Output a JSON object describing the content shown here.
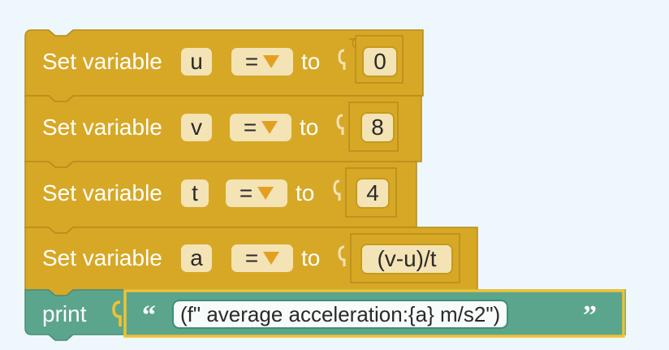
{
  "workspace": {
    "blocks": [
      {
        "kind": "set_variable",
        "label": "Set variable",
        "variable": "u",
        "operator": "=",
        "to_label": "to",
        "value": "0"
      },
      {
        "kind": "set_variable",
        "label": "Set variable",
        "variable": "v",
        "operator": "=",
        "to_label": "to",
        "value": "8"
      },
      {
        "kind": "set_variable",
        "label": "Set variable",
        "variable": "t",
        "operator": "=",
        "to_label": "to",
        "value": "4"
      },
      {
        "kind": "set_variable",
        "label": "Set variable",
        "variable": "a",
        "operator": "=",
        "to_label": "to",
        "value": "(v-u)/t"
      }
    ],
    "print_block": {
      "label": "print",
      "open_quote": "“",
      "text": "(f\" average acceleration:{a} m/s2\")",
      "close_quote": "”"
    }
  },
  "colors": {
    "background": "#eef7fc",
    "variable_block": "#d7a826",
    "variable_block_border": "#b58c1c",
    "value_socket": "#d7a826",
    "print_block": "#5ba58c",
    "string_block": "#5ba58c",
    "string_block_outline": "#f1c232",
    "dropdown_arrow": "#e3a020"
  }
}
